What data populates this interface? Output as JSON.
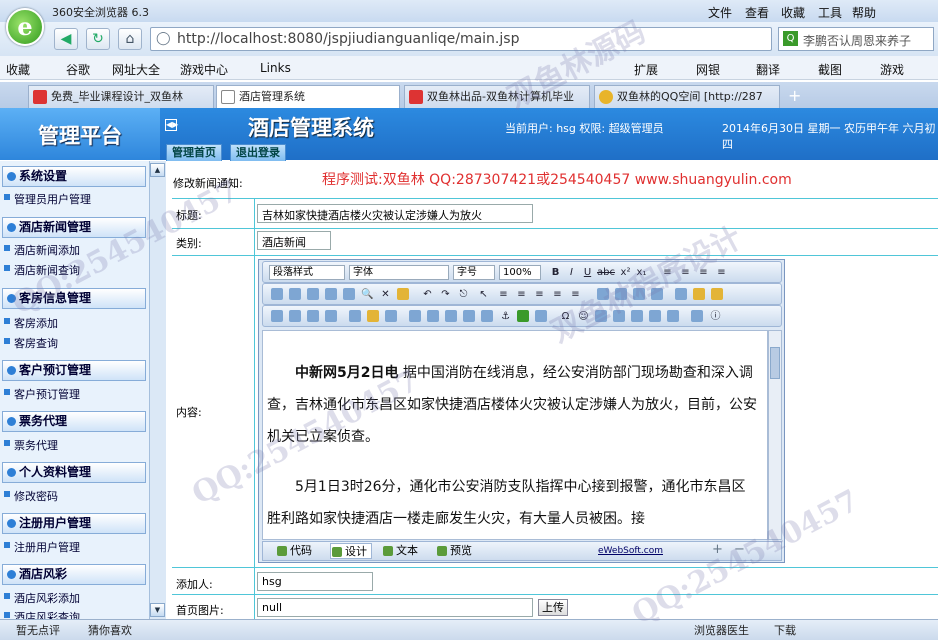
{
  "browser": {
    "app_name": "360安全浏览器 6.3",
    "menu": [
      "文件",
      "查看",
      "收藏",
      "工具",
      "帮助"
    ],
    "url": "http://localhost:8080/jspjiudianguanliqe/main.jsp",
    "search_text": "李鹏否认周恩来养子",
    "favorites": [
      "收藏",
      "谷歌",
      "网址大全",
      "游戏中心",
      "Links"
    ],
    "fav_tools": [
      "扩展",
      "网银",
      "翻译",
      "截图",
      "游戏"
    ],
    "tabs": [
      {
        "label": "免费_毕业课程设计_双鱼林"
      },
      {
        "label": "酒店管理系统"
      },
      {
        "label": "双鱼林出品-双鱼林计算机毕业"
      },
      {
        "label": "双鱼林的QQ空间 [http://287"
      }
    ]
  },
  "header": {
    "platform": "管理平台",
    "system_title": "酒店管理系统",
    "user_info": "当前用户: hsg 权限: 超级管理员",
    "date_info": "2014年6月30日 星期一 农历甲午年 六月初四",
    "nav": [
      "管理首页",
      "退出登录"
    ]
  },
  "sidebar": {
    "groups": [
      {
        "title": "系统设置",
        "items": [
          "管理员用户管理"
        ]
      },
      {
        "title": "酒店新闻管理",
        "items": [
          "酒店新闻添加",
          "酒店新闻查询"
        ]
      },
      {
        "title": "客房信息管理",
        "items": [
          "客房添加",
          "客房查询"
        ]
      },
      {
        "title": "客户预订管理",
        "items": [
          "客户预订管理"
        ]
      },
      {
        "title": "票务代理",
        "items": [
          "票务代理"
        ]
      },
      {
        "title": "个人资料管理",
        "items": [
          "修改密码"
        ]
      },
      {
        "title": "注册用户管理",
        "items": [
          "注册用户管理"
        ]
      },
      {
        "title": "酒店风彩",
        "items": [
          "酒店风彩添加",
          "酒店风彩查询"
        ]
      }
    ]
  },
  "form": {
    "heading": "修改新闻通知:",
    "test_notice": "程序测试:双鱼林 QQ:287307421或254540457 www.shuangyulin.com",
    "title_label": "标题:",
    "title_value": "吉林如家快捷酒店楼火灾被认定涉嫌人为放火",
    "category_label": "类别:",
    "category_value": "酒店新闻",
    "content_label": "内容:",
    "adder_label": "添加人:",
    "adder_value": "hsg",
    "image_label": "首页图片:",
    "image_value": "null",
    "upload_label": "上传"
  },
  "editor": {
    "format_select": "段落样式",
    "font_select": "字体",
    "size_select": "字号",
    "zoom_select": "100%",
    "para1_bold": "中新网5月2日电",
    "para1_rest": " 据中国消防在线消息，经公安消防部门现场勘查和深入调查，吉林通化市东昌区如家快捷酒店楼体火灾被认定涉嫌人为放火，目前，公安机关已立案侦查。",
    "para2": "5月1日3时26分，通化市公安消防支队指挥中心接到报警，通化市东昌区胜利路如家快捷酒店一楼走廊发生火灾，有大量人员被困。接",
    "modes": [
      "代码",
      "设计",
      "文本",
      "预览"
    ],
    "credit": "eWebSoft.com"
  },
  "status": {
    "left": [
      "暂无点评",
      "猜你喜欢"
    ],
    "right": [
      "浏览器医生",
      "下载"
    ]
  },
  "watermark": {
    "text1": "双鱼林源码",
    "text2": "QQ:254540457",
    "text3": "双鱼林程序设计"
  },
  "colors": {
    "accent": "#1f6fc7",
    "notice": "#e03030",
    "border_cyan": "#4fc6d8"
  }
}
